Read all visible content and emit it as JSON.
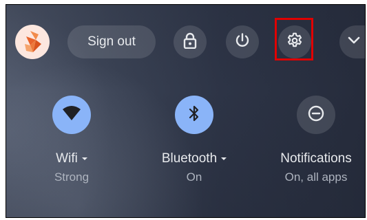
{
  "top_bar": {
    "avatar_icon": "fox-avatar-icon",
    "sign_out_label": "Sign out",
    "lock_icon": "lock-icon",
    "power_icon": "power-icon",
    "settings_icon": "gear-icon",
    "expand_icon": "chevron-down-icon"
  },
  "tiles": [
    {
      "label": "Wifi",
      "status": "Strong",
      "icon": "wifi-icon",
      "active": true,
      "has_menu": true
    },
    {
      "label": "Bluetooth",
      "status": "On",
      "icon": "bluetooth-icon",
      "active": true,
      "has_menu": true
    },
    {
      "label": "Notifications",
      "status": "On, all apps",
      "icon": "do-not-disturb-icon",
      "active": false,
      "has_menu": false
    }
  ],
  "colors": {
    "active_tile": "#8ab4f8",
    "text": "#e8eaed",
    "subtext": "#aeb4bf",
    "highlight_box": "#e00000"
  }
}
